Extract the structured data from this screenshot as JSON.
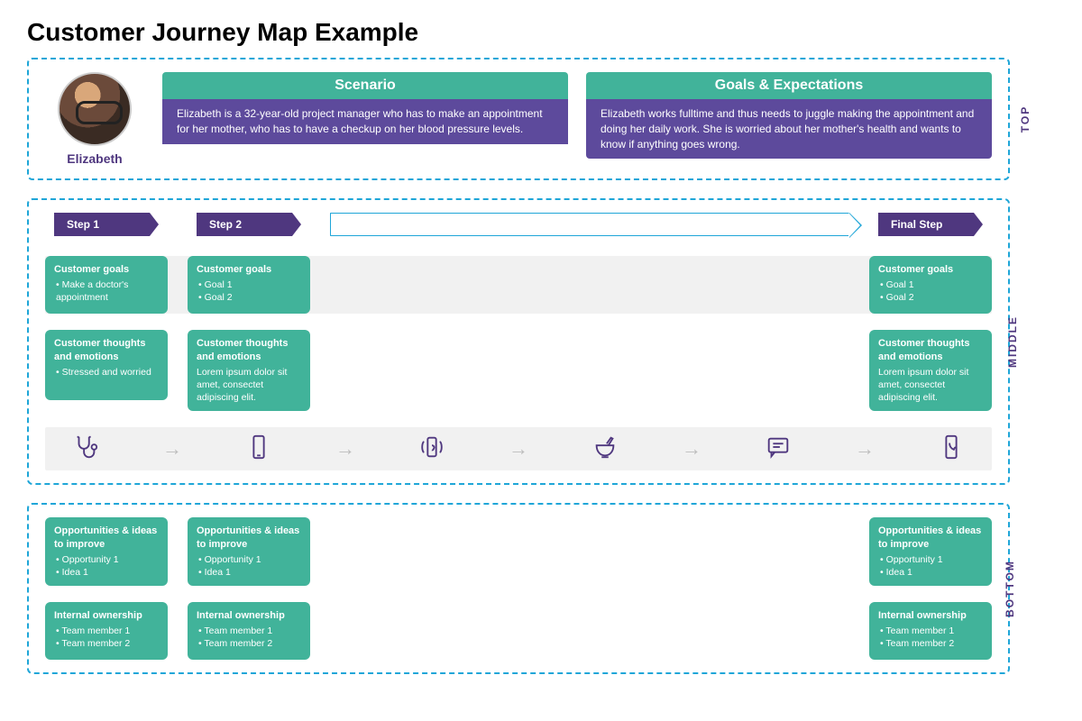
{
  "title": "Customer Journey Map Example",
  "zone_labels": {
    "top": "TOP",
    "middle": "MIDDLE",
    "bottom": "BOTTOM"
  },
  "persona": {
    "name": "Elizabeth"
  },
  "scenario": {
    "heading": "Scenario",
    "body": "Elizabeth is a 32-year-old project manager who has to make an appointment for her mother, who has to have a checkup on her blood pressure levels."
  },
  "goals_expectations": {
    "heading": "Goals & Expectations",
    "body": "Elizabeth works fulltime and thus needs to juggle making the appointment and doing her daily work. She is worried about her mother's health and wants to know if anything goes wrong."
  },
  "steps": {
    "step1": {
      "label": "Step 1"
    },
    "step2": {
      "label": "Step 2"
    },
    "final": {
      "label": "Final Step"
    }
  },
  "middle": {
    "step1": {
      "goals": {
        "title": "Customer goals",
        "items": [
          "Make a doctor's appointment"
        ]
      },
      "thoughts": {
        "title": "Customer thoughts and emotions",
        "items": [
          "Stressed and worried"
        ]
      }
    },
    "step2": {
      "goals": {
        "title": "Customer goals",
        "items": [
          "Goal 1",
          "Goal 2"
        ]
      },
      "thoughts": {
        "title": "Customer thoughts and emotions",
        "body": "Lorem ipsum dolor sit amet, consectet adipiscing elit."
      }
    },
    "final": {
      "goals": {
        "title": "Customer goals",
        "items": [
          "Goal 1",
          "Goal 2"
        ]
      },
      "thoughts": {
        "title": "Customer thoughts and emotions",
        "body": "Lorem ipsum dolor sit amet, consectet adipiscing elit."
      }
    }
  },
  "bottom": {
    "step1": {
      "opps": {
        "title": "Opportunities & ideas to improve",
        "items": [
          "Opportunity 1",
          "Idea 1"
        ]
      },
      "owner": {
        "title": "Internal ownership",
        "items": [
          "Team member 1",
          "Team member 2"
        ]
      }
    },
    "step2": {
      "opps": {
        "title": "Opportunities & ideas to improve",
        "items": [
          "Opportunity 1",
          "Idea 1"
        ]
      },
      "owner": {
        "title": "Internal ownership",
        "items": [
          "Team member 1",
          "Team member 2"
        ]
      }
    },
    "final": {
      "opps": {
        "title": "Opportunities & ideas to improve",
        "items": [
          "Opportunity 1",
          "Idea 1"
        ]
      },
      "owner": {
        "title": "Internal ownership",
        "items": [
          "Team member 1",
          "Team member 2"
        ]
      }
    }
  },
  "icons": [
    "stethoscope",
    "phone",
    "phone-ring",
    "mortar",
    "chat",
    "phone-call"
  ]
}
